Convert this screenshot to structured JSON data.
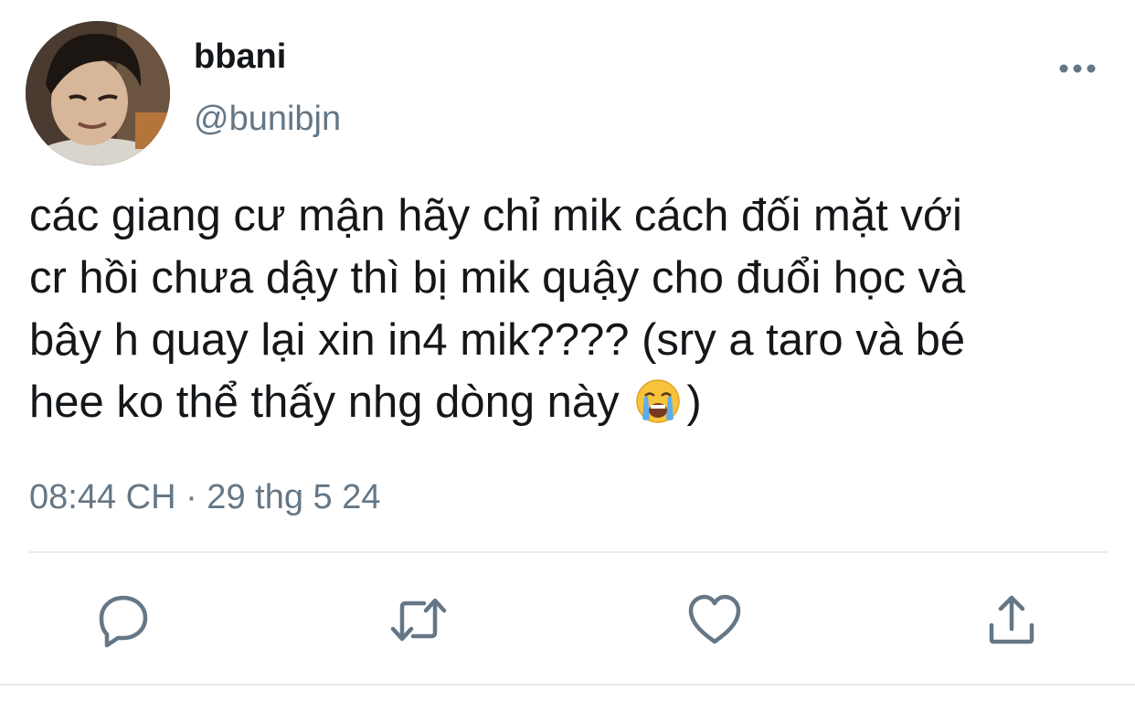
{
  "user": {
    "display_name": "bbani",
    "handle": "@bunibjn"
  },
  "tweet": {
    "text_before_emoji": "các giang cư mận hãy chỉ mik cách đối mặt với\ncr hồi chưa dậy thì bị mik quậy cho đuổi học và\nbây h quay lại xin in4 mik???? (sry a taro và bé\nhee ko thể thấy nhg dòng này ",
    "emoji": "loudly-crying-face-emoji",
    "text_after_emoji": ")",
    "timestamp": "08:44 CH · 29 thg 5 24"
  },
  "actions": {
    "reply_icon": "reply-icon",
    "retweet_icon": "retweet-icon",
    "like_icon": "like-icon",
    "share_icon": "share-icon"
  },
  "colors": {
    "text": "#14171a",
    "secondary": "#657786",
    "icon": "#657786",
    "divider": "#e6ecf0"
  }
}
